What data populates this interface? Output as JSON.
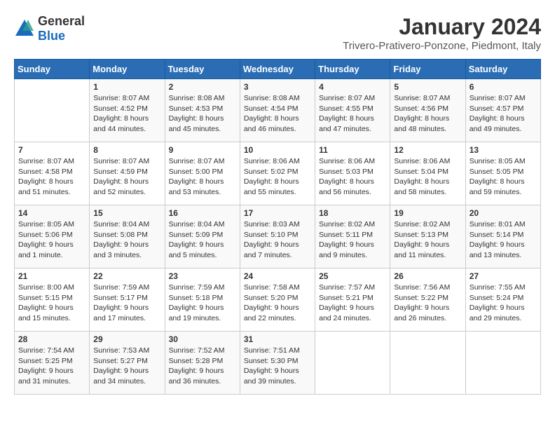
{
  "logo": {
    "text_general": "General",
    "text_blue": "Blue"
  },
  "title": "January 2024",
  "subtitle": "Trivero-Prativero-Ponzone, Piedmont, Italy",
  "weekdays": [
    "Sunday",
    "Monday",
    "Tuesday",
    "Wednesday",
    "Thursday",
    "Friday",
    "Saturday"
  ],
  "weeks": [
    [
      {
        "day": "",
        "sunrise": "",
        "sunset": "",
        "daylight": ""
      },
      {
        "day": "1",
        "sunrise": "Sunrise: 8:07 AM",
        "sunset": "Sunset: 4:52 PM",
        "daylight": "Daylight: 8 hours and 44 minutes."
      },
      {
        "day": "2",
        "sunrise": "Sunrise: 8:08 AM",
        "sunset": "Sunset: 4:53 PM",
        "daylight": "Daylight: 8 hours and 45 minutes."
      },
      {
        "day": "3",
        "sunrise": "Sunrise: 8:08 AM",
        "sunset": "Sunset: 4:54 PM",
        "daylight": "Daylight: 8 hours and 46 minutes."
      },
      {
        "day": "4",
        "sunrise": "Sunrise: 8:07 AM",
        "sunset": "Sunset: 4:55 PM",
        "daylight": "Daylight: 8 hours and 47 minutes."
      },
      {
        "day": "5",
        "sunrise": "Sunrise: 8:07 AM",
        "sunset": "Sunset: 4:56 PM",
        "daylight": "Daylight: 8 hours and 48 minutes."
      },
      {
        "day": "6",
        "sunrise": "Sunrise: 8:07 AM",
        "sunset": "Sunset: 4:57 PM",
        "daylight": "Daylight: 8 hours and 49 minutes."
      }
    ],
    [
      {
        "day": "7",
        "sunrise": "Sunrise: 8:07 AM",
        "sunset": "Sunset: 4:58 PM",
        "daylight": "Daylight: 8 hours and 51 minutes."
      },
      {
        "day": "8",
        "sunrise": "Sunrise: 8:07 AM",
        "sunset": "Sunset: 4:59 PM",
        "daylight": "Daylight: 8 hours and 52 minutes."
      },
      {
        "day": "9",
        "sunrise": "Sunrise: 8:07 AM",
        "sunset": "Sunset: 5:00 PM",
        "daylight": "Daylight: 8 hours and 53 minutes."
      },
      {
        "day": "10",
        "sunrise": "Sunrise: 8:06 AM",
        "sunset": "Sunset: 5:02 PM",
        "daylight": "Daylight: 8 hours and 55 minutes."
      },
      {
        "day": "11",
        "sunrise": "Sunrise: 8:06 AM",
        "sunset": "Sunset: 5:03 PM",
        "daylight": "Daylight: 8 hours and 56 minutes."
      },
      {
        "day": "12",
        "sunrise": "Sunrise: 8:06 AM",
        "sunset": "Sunset: 5:04 PM",
        "daylight": "Daylight: 8 hours and 58 minutes."
      },
      {
        "day": "13",
        "sunrise": "Sunrise: 8:05 AM",
        "sunset": "Sunset: 5:05 PM",
        "daylight": "Daylight: 8 hours and 59 minutes."
      }
    ],
    [
      {
        "day": "14",
        "sunrise": "Sunrise: 8:05 AM",
        "sunset": "Sunset: 5:06 PM",
        "daylight": "Daylight: 9 hours and 1 minute."
      },
      {
        "day": "15",
        "sunrise": "Sunrise: 8:04 AM",
        "sunset": "Sunset: 5:08 PM",
        "daylight": "Daylight: 9 hours and 3 minutes."
      },
      {
        "day": "16",
        "sunrise": "Sunrise: 8:04 AM",
        "sunset": "Sunset: 5:09 PM",
        "daylight": "Daylight: 9 hours and 5 minutes."
      },
      {
        "day": "17",
        "sunrise": "Sunrise: 8:03 AM",
        "sunset": "Sunset: 5:10 PM",
        "daylight": "Daylight: 9 hours and 7 minutes."
      },
      {
        "day": "18",
        "sunrise": "Sunrise: 8:02 AM",
        "sunset": "Sunset: 5:11 PM",
        "daylight": "Daylight: 9 hours and 9 minutes."
      },
      {
        "day": "19",
        "sunrise": "Sunrise: 8:02 AM",
        "sunset": "Sunset: 5:13 PM",
        "daylight": "Daylight: 9 hours and 11 minutes."
      },
      {
        "day": "20",
        "sunrise": "Sunrise: 8:01 AM",
        "sunset": "Sunset: 5:14 PM",
        "daylight": "Daylight: 9 hours and 13 minutes."
      }
    ],
    [
      {
        "day": "21",
        "sunrise": "Sunrise: 8:00 AM",
        "sunset": "Sunset: 5:15 PM",
        "daylight": "Daylight: 9 hours and 15 minutes."
      },
      {
        "day": "22",
        "sunrise": "Sunrise: 7:59 AM",
        "sunset": "Sunset: 5:17 PM",
        "daylight": "Daylight: 9 hours and 17 minutes."
      },
      {
        "day": "23",
        "sunrise": "Sunrise: 7:59 AM",
        "sunset": "Sunset: 5:18 PM",
        "daylight": "Daylight: 9 hours and 19 minutes."
      },
      {
        "day": "24",
        "sunrise": "Sunrise: 7:58 AM",
        "sunset": "Sunset: 5:20 PM",
        "daylight": "Daylight: 9 hours and 22 minutes."
      },
      {
        "day": "25",
        "sunrise": "Sunrise: 7:57 AM",
        "sunset": "Sunset: 5:21 PM",
        "daylight": "Daylight: 9 hours and 24 minutes."
      },
      {
        "day": "26",
        "sunrise": "Sunrise: 7:56 AM",
        "sunset": "Sunset: 5:22 PM",
        "daylight": "Daylight: 9 hours and 26 minutes."
      },
      {
        "day": "27",
        "sunrise": "Sunrise: 7:55 AM",
        "sunset": "Sunset: 5:24 PM",
        "daylight": "Daylight: 9 hours and 29 minutes."
      }
    ],
    [
      {
        "day": "28",
        "sunrise": "Sunrise: 7:54 AM",
        "sunset": "Sunset: 5:25 PM",
        "daylight": "Daylight: 9 hours and 31 minutes."
      },
      {
        "day": "29",
        "sunrise": "Sunrise: 7:53 AM",
        "sunset": "Sunset: 5:27 PM",
        "daylight": "Daylight: 9 hours and 34 minutes."
      },
      {
        "day": "30",
        "sunrise": "Sunrise: 7:52 AM",
        "sunset": "Sunset: 5:28 PM",
        "daylight": "Daylight: 9 hours and 36 minutes."
      },
      {
        "day": "31",
        "sunrise": "Sunrise: 7:51 AM",
        "sunset": "Sunset: 5:30 PM",
        "daylight": "Daylight: 9 hours and 39 minutes."
      },
      {
        "day": "",
        "sunrise": "",
        "sunset": "",
        "daylight": ""
      },
      {
        "day": "",
        "sunrise": "",
        "sunset": "",
        "daylight": ""
      },
      {
        "day": "",
        "sunrise": "",
        "sunset": "",
        "daylight": ""
      }
    ]
  ]
}
